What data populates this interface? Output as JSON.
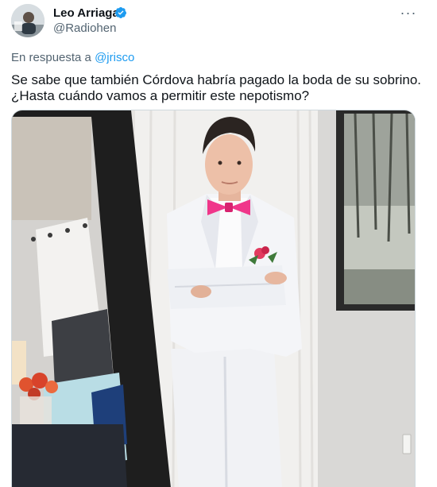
{
  "author": {
    "name": "Leo Arriaga",
    "handle": "@Radiohen",
    "verified": true,
    "avatar_icon": "user-avatar"
  },
  "menu": {
    "more_label": "···"
  },
  "reply": {
    "prefix": "En respuesta a",
    "mention": "@jrisco"
  },
  "tweet": {
    "lines": [
      "Se sabe que también Córdova habría pagado la boda de su sobrino.",
      "¿Hasta cuándo vamos a permitir este nepotismo?"
    ]
  },
  "media": {
    "kind": "photo",
    "alt": "Hombre con traje blanco y moño rosa posando junto a un espejo"
  },
  "colors": {
    "link": "#1d9bf0",
    "verified_badge": "#1d9bf0",
    "secondary_text": "#536471",
    "primary_text": "#0f1419",
    "bow_tie": "#f0368a"
  }
}
